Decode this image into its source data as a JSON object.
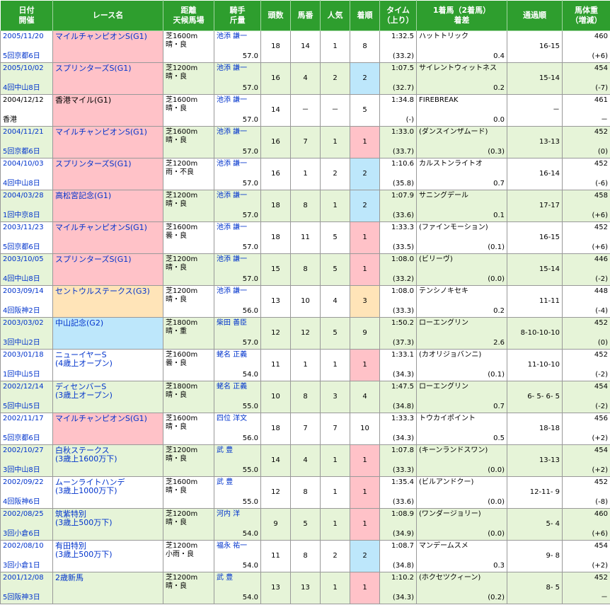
{
  "headers": {
    "date": [
      "日付",
      "開催"
    ],
    "race": "レース名",
    "distance": [
      "距離",
      "天候馬場"
    ],
    "jockey": [
      "騎手",
      "斤量"
    ],
    "runners": "頭数",
    "number": "馬番",
    "pop": "人気",
    "finish": "着順",
    "time": [
      "タイム",
      "（上り）"
    ],
    "winner": [
      "1着馬（2着馬）",
      "着差"
    ],
    "passing": "通過順",
    "weight": [
      "馬体重",
      "（増減）"
    ]
  },
  "rows": [
    {
      "date": "2005/11/20",
      "meet": "5回京都6日",
      "race": "マイルチャンピオンS(G1)",
      "race2": "",
      "grade": "g1",
      "course": "芝1600m",
      "cond": "晴・良",
      "jockey": "池添 謙一",
      "kin": "57.0",
      "runners": "18",
      "num": "14",
      "pop": "1",
      "pos": "8",
      "time": "1:32.5",
      "last": "(33.2)",
      "winner": "ハットトリック",
      "margin": "0.4",
      "passing": "16-15",
      "bw": "460",
      "diff": "(+6)"
    },
    {
      "date": "2005/10/02",
      "meet": "4回中山8日",
      "race": "スプリンターズS(G1)",
      "race2": "",
      "grade": "g1",
      "course": "芝1200m",
      "cond": "晴・良",
      "jockey": "池添 謙一",
      "kin": "57.0",
      "runners": "16",
      "num": "4",
      "pop": "2",
      "pos": "2",
      "time": "1:07.5",
      "last": "(32.7)",
      "winner": "サイレントウィットネス",
      "margin": "0.2",
      "passing": "15-14",
      "bw": "454",
      "diff": "(-7)"
    },
    {
      "date": "2004/12/12",
      "meet": "香港",
      "race": "香港マイル(G1)",
      "race2": "",
      "grade": "g1",
      "course": "芝1600m",
      "cond": "晴・良",
      "jockey": "池添 謙一",
      "kin": "57.0",
      "runners": "14",
      "num": "－",
      "pop": "－",
      "pos": "5",
      "time": "1:34.8",
      "last": "(-)",
      "winner": "FIREBREAK",
      "margin": "0.0",
      "passing": "－",
      "bw": "461",
      "diff": "－",
      "plain": true
    },
    {
      "date": "2004/11/21",
      "meet": "5回京都6日",
      "race": "マイルチャンピオンS(G1)",
      "race2": "",
      "grade": "g1",
      "course": "芝1600m",
      "cond": "晴・良",
      "jockey": "池添 謙一",
      "kin": "57.0",
      "runners": "16",
      "num": "7",
      "pop": "1",
      "pos": "1",
      "time": "1:33.0",
      "last": "(33.7)",
      "winner": "(ダンスインザムード)",
      "margin": "(0.3)",
      "passing": "13-13",
      "bw": "452",
      "diff": "(0)"
    },
    {
      "date": "2004/10/03",
      "meet": "4回中山8日",
      "race": "スプリンターズS(G1)",
      "race2": "",
      "grade": "g1",
      "course": "芝1200m",
      "cond": "雨・不良",
      "jockey": "池添 謙一",
      "kin": "57.0",
      "runners": "16",
      "num": "1",
      "pop": "2",
      "pos": "2",
      "time": "1:10.6",
      "last": "(35.8)",
      "winner": "カルストンライトオ",
      "margin": "0.7",
      "passing": "16-14",
      "bw": "452",
      "diff": "(-6)"
    },
    {
      "date": "2004/03/28",
      "meet": "1回中京8日",
      "race": "高松宮記念(G1)",
      "race2": "",
      "grade": "g1",
      "course": "芝1200m",
      "cond": "晴・良",
      "jockey": "池添 謙一",
      "kin": "57.0",
      "runners": "18",
      "num": "8",
      "pop": "1",
      "pos": "2",
      "time": "1:07.9",
      "last": "(33.6)",
      "winner": "サニングデール",
      "margin": "0.1",
      "passing": "17-17",
      "bw": "458",
      "diff": "(+6)"
    },
    {
      "date": "2003/11/23",
      "meet": "5回京都6日",
      "race": "マイルチャンピオンS(G1)",
      "race2": "",
      "grade": "g1",
      "course": "芝1600m",
      "cond": "曇・良",
      "jockey": "池添 謙一",
      "kin": "57.0",
      "runners": "18",
      "num": "11",
      "pop": "5",
      "pos": "1",
      "time": "1:33.3",
      "last": "(33.5)",
      "winner": "(ファインモーション)",
      "margin": "(0.1)",
      "passing": "16-15",
      "bw": "452",
      "diff": "(+6)"
    },
    {
      "date": "2003/10/05",
      "meet": "4回中山8日",
      "race": "スプリンターズS(G1)",
      "race2": "",
      "grade": "g1",
      "course": "芝1200m",
      "cond": "晴・良",
      "jockey": "池添 謙一",
      "kin": "57.0",
      "runners": "15",
      "num": "8",
      "pop": "5",
      "pos": "1",
      "time": "1:08.0",
      "last": "(33.2)",
      "winner": "(ビリーヴ)",
      "margin": "(0.0)",
      "passing": "15-14",
      "bw": "446",
      "diff": "(-2)"
    },
    {
      "date": "2003/09/14",
      "meet": "4回阪神2日",
      "race": "セントウルステークス(G3)",
      "race2": "",
      "grade": "g3",
      "course": "芝1200m",
      "cond": "晴・良",
      "jockey": "池添 謙一",
      "kin": "56.0",
      "runners": "13",
      "num": "10",
      "pop": "4",
      "pos": "3",
      "time": "1:08.0",
      "last": "(33.3)",
      "winner": "テンシノキセキ",
      "margin": "0.2",
      "passing": "11-11",
      "bw": "448",
      "diff": "(-4)"
    },
    {
      "date": "2003/03/02",
      "meet": "3回中山2日",
      "race": "中山記念(G2)",
      "race2": "",
      "grade": "g2",
      "course": "芝1800m",
      "cond": "晴・重",
      "jockey": "柴田 善臣",
      "kin": "57.0",
      "runners": "12",
      "num": "12",
      "pop": "5",
      "pos": "9",
      "time": "1:50.2",
      "last": "(37.3)",
      "winner": "ローエングリン",
      "margin": "2.6",
      "passing": "8-10-10-10",
      "bw": "452",
      "diff": "(0)"
    },
    {
      "date": "2003/01/18",
      "meet": "1回中山5日",
      "race": "ニューイヤーS",
      "race2": "(4歳上オープン)",
      "grade": "",
      "course": "芝1600m",
      "cond": "曇・良",
      "jockey": "蛯名 正義",
      "kin": "54.0",
      "runners": "11",
      "num": "1",
      "pop": "1",
      "pos": "1",
      "time": "1:33.1",
      "last": "(34.3)",
      "winner": "(カオリジョバンニ)",
      "margin": "(0.1)",
      "passing": "11-10-10",
      "bw": "452",
      "diff": "(-2)"
    },
    {
      "date": "2002/12/14",
      "meet": "5回中山5日",
      "race": "ディセンバーS",
      "race2": "(3歳上オープン)",
      "grade": "",
      "course": "芝1800m",
      "cond": "晴・良",
      "jockey": "蛯名 正義",
      "kin": "55.0",
      "runners": "10",
      "num": "8",
      "pop": "3",
      "pos": "4",
      "time": "1:47.5",
      "last": "(34.8)",
      "winner": "ローエングリン",
      "margin": "0.7",
      "passing": "6- 5- 6- 5",
      "bw": "454",
      "diff": "(-2)"
    },
    {
      "date": "2002/11/17",
      "meet": "5回京都6日",
      "race": "マイルチャンピオンS(G1)",
      "race2": "",
      "grade": "g1",
      "course": "芝1600m",
      "cond": "晴・良",
      "jockey": "四位 洋文",
      "kin": "56.0",
      "runners": "18",
      "num": "7",
      "pop": "7",
      "pos": "10",
      "time": "1:33.3",
      "last": "(34.3)",
      "winner": "トウカイポイント",
      "margin": "0.5",
      "passing": "18-18",
      "bw": "456",
      "diff": "(+2)"
    },
    {
      "date": "2002/10/27",
      "meet": "3回中山8日",
      "race": "白秋ステークス",
      "race2": "(3歳上1600万下)",
      "grade": "",
      "course": "芝1200m",
      "cond": "晴・良",
      "jockey": "武 豊",
      "kin": "55.0",
      "runners": "14",
      "num": "4",
      "pop": "1",
      "pos": "1",
      "time": "1:07.8",
      "last": "(33.3)",
      "winner": "(キーンランドスワン)",
      "margin": "(0.0)",
      "passing": "13-13",
      "bw": "454",
      "diff": "(+2)"
    },
    {
      "date": "2002/09/22",
      "meet": "4回阪神6日",
      "race": "ムーンライトハンデ",
      "race2": "(3歳上1000万下)",
      "grade": "",
      "course": "芝1600m",
      "cond": "晴・良",
      "jockey": "武 豊",
      "kin": "55.0",
      "runners": "12",
      "num": "8",
      "pop": "1",
      "pos": "1",
      "time": "1:35.4",
      "last": "(33.6)",
      "winner": "(ビルアンドクー)",
      "margin": "(0.0)",
      "passing": "12-11- 9",
      "bw": "452",
      "diff": "(-8)"
    },
    {
      "date": "2002/08/25",
      "meet": "3回小倉6日",
      "race": "筑紫特別",
      "race2": "(3歳上500万下)",
      "grade": "",
      "course": "芝1200m",
      "cond": "晴・良",
      "jockey": "河内 洋",
      "kin": "54.0",
      "runners": "9",
      "num": "5",
      "pop": "1",
      "pos": "1",
      "time": "1:08.9",
      "last": "(34.9)",
      "winner": "(ワンダージョリー)",
      "margin": "(0.0)",
      "passing": "5- 4",
      "bw": "460",
      "diff": "(+6)"
    },
    {
      "date": "2002/08/10",
      "meet": "3回小倉1日",
      "race": "有田特別",
      "race2": "(3歳上500万下)",
      "grade": "",
      "course": "芝1200m",
      "cond": "小雨・良",
      "jockey": "福永 祐一",
      "kin": "54.0",
      "runners": "11",
      "num": "8",
      "pop": "2",
      "pos": "2",
      "time": "1:08.7",
      "last": "(34.8)",
      "winner": "マンデームスメ",
      "margin": "0.3",
      "passing": "9- 8",
      "bw": "454",
      "diff": "(+2)"
    },
    {
      "date": "2001/12/08",
      "meet": "5回阪神3日",
      "race": "2歳新馬",
      "race2": "",
      "grade": "",
      "course": "芝1200m",
      "cond": "晴・良",
      "jockey": "武 豊",
      "kin": "54.0",
      "runners": "13",
      "num": "13",
      "pop": "1",
      "pos": "1",
      "time": "1:10.2",
      "last": "(34.3)",
      "winner": "(ホクセツクィーン)",
      "margin": "(0.2)",
      "passing": "8- 5",
      "bw": "452",
      "diff": "－"
    }
  ]
}
